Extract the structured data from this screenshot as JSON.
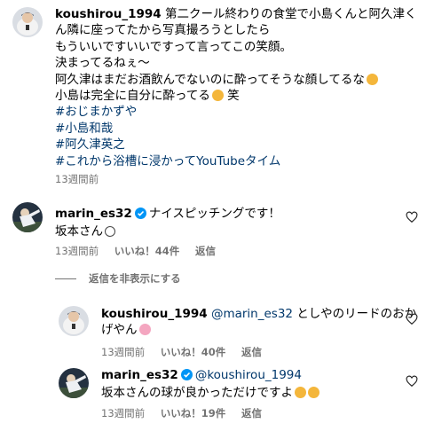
{
  "post": {
    "username": "koushirou_1994",
    "caption_lines": [
      "第二クール終わりの食堂で小島くんと阿久津く",
      "ん隣に座ってたから写真撮ろうとしたら",
      "もういいですいいですって言ってこの笑顔。",
      "決まってるねぇ～",
      "阿久津はまだお酒飲んでないのに酔ってそうな顔してるな",
      "小島は完全に自分に酔ってる",
      "笑"
    ],
    "hashtags": [
      "#おじまかずや",
      "#小島和哉",
      "#阿久津英之",
      "#これから浴槽に浸かってYouTubeタイム"
    ],
    "time": "13週間前"
  },
  "comments": [
    {
      "username": "marin_es32",
      "verified": true,
      "text_line1": "ナイスピッチングです！",
      "text_line2": "坂本さん",
      "time": "13週間前",
      "likes": "いいね！44件",
      "reply": "返信"
    }
  ],
  "hide_replies_label": "返信を非表示にする",
  "replies": [
    {
      "username": "koushirou_1994",
      "mention": "@marin_es32",
      "text_a": "としやのリードのおか",
      "text_b": "げやん",
      "time": "13週間前",
      "likes": "いいね！40件",
      "reply": "返信"
    },
    {
      "username": "marin_es32",
      "verified": true,
      "mention": "@koushirou_1994",
      "text": "坂本さんの球が良かっただけですよ",
      "time": "13週間前",
      "likes": "いいね！19件",
      "reply": "返信"
    }
  ],
  "colors": {
    "hashtag": "#00376b",
    "meta": "#737373",
    "verified": "#0095f6"
  }
}
